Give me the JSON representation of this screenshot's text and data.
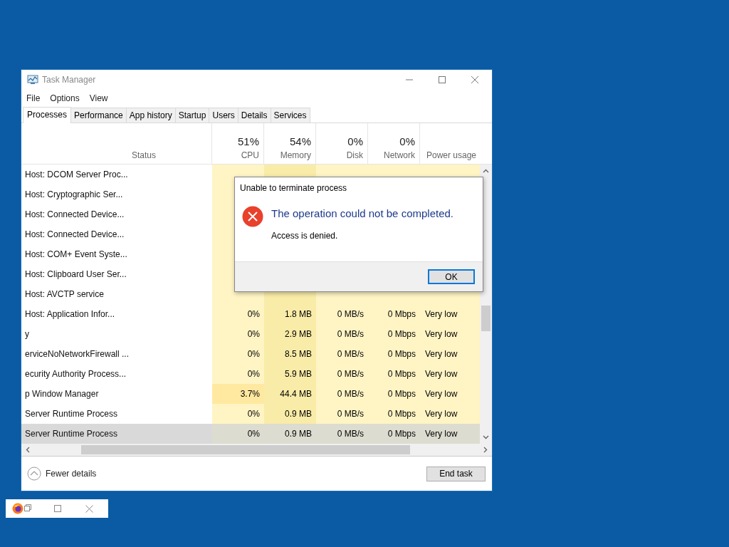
{
  "window": {
    "title": "Task Manager"
  },
  "menu": [
    "File",
    "Options",
    "View"
  ],
  "tabs": [
    {
      "label": "Processes",
      "selected": true
    },
    {
      "label": "Performance",
      "selected": false
    },
    {
      "label": "App history",
      "selected": false
    },
    {
      "label": "Startup",
      "selected": false
    },
    {
      "label": "Users",
      "selected": false
    },
    {
      "label": "Details",
      "selected": false
    },
    {
      "label": "Services",
      "selected": false
    }
  ],
  "columns": [
    {
      "label": "Status"
    },
    {
      "percent": "51%",
      "label": "CPU"
    },
    {
      "percent": "54%",
      "label": "Memory"
    },
    {
      "percent": "0%",
      "label": "Disk"
    },
    {
      "percent": "0%",
      "label": "Network"
    },
    {
      "label": "Power usage"
    }
  ],
  "rows": [
    {
      "name": "Host: DCOM Server Proc...",
      "busy": false,
      "selected": false
    },
    {
      "name": "Host: Cryptographic Ser...",
      "busy": false,
      "selected": false
    },
    {
      "name": "Host: Connected Device...",
      "busy": false,
      "selected": false
    },
    {
      "name": "Host: Connected Device...",
      "busy": false,
      "selected": false
    },
    {
      "name": "Host: COM+ Event Syste...",
      "busy": false,
      "selected": false
    },
    {
      "name": "Host: Clipboard User Ser...",
      "busy": false,
      "selected": false
    },
    {
      "name": "Host: AVCTP service",
      "busy": false,
      "selected": false
    },
    {
      "name": "Host: Application Infor...",
      "cpu": "0%",
      "memory": "1.8 MB",
      "disk": "0 MB/s",
      "network": "0 Mbps",
      "power": "Very low",
      "busy": false,
      "selected": false
    },
    {
      "name": "y",
      "cpu": "0%",
      "memory": "2.9 MB",
      "disk": "0 MB/s",
      "network": "0 Mbps",
      "power": "Very low",
      "busy": false,
      "selected": false
    },
    {
      "name": "erviceNoNetworkFirewall ...",
      "cpu": "0%",
      "memory": "8.5 MB",
      "disk": "0 MB/s",
      "network": "0 Mbps",
      "power": "Very low",
      "busy": false,
      "selected": false
    },
    {
      "name": "ecurity Authority Process...",
      "cpu": "0%",
      "memory": "5.9 MB",
      "disk": "0 MB/s",
      "network": "0 Mbps",
      "power": "Very low",
      "busy": false,
      "selected": false
    },
    {
      "name": "p Window Manager",
      "cpu": "3.7%",
      "memory": "44.4 MB",
      "disk": "0 MB/s",
      "network": "0 Mbps",
      "power": "Very low",
      "busy": true,
      "selected": false
    },
    {
      "name": "Server Runtime Process",
      "cpu": "0%",
      "memory": "0.9 MB",
      "disk": "0 MB/s",
      "network": "0 Mbps",
      "power": "Very low",
      "busy": false,
      "selected": false
    },
    {
      "name": "Server Runtime Process",
      "cpu": "0%",
      "memory": "0.9 MB",
      "disk": "0 MB/s",
      "network": "0 Mbps",
      "power": "Very low",
      "busy": false,
      "selected": true
    }
  ],
  "footer": {
    "details": "Fewer details",
    "end_task": "End task"
  },
  "dialog": {
    "title": "Unable to terminate process",
    "instruction": "The operation could not be completed.",
    "message": "Access is denied.",
    "button": "OK"
  }
}
